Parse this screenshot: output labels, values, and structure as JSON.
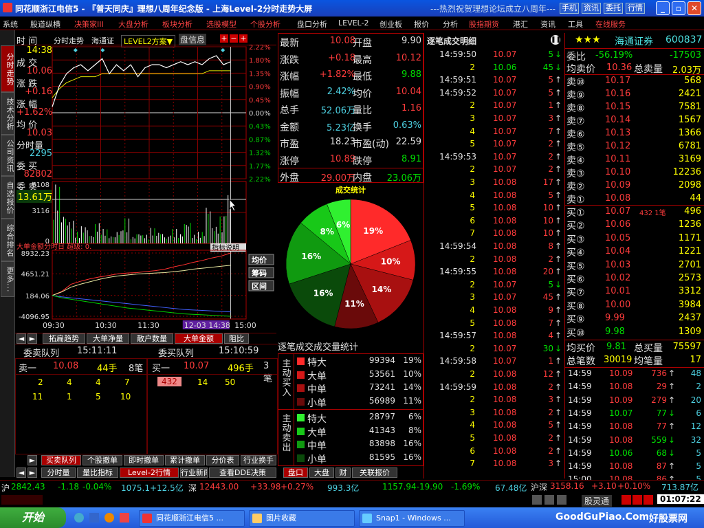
{
  "window": {
    "app_name": "同花顺浙江电信5",
    "title_mid": "『普天同庆』理想八周年纪念版",
    "title_right": "上海Level-2分时走势大屏",
    "marquee": "---热烈祝贺理想论坛成立八周年---",
    "buttons": [
      "手机",
      "资讯",
      "委托",
      "行情"
    ],
    "controls": [
      "_",
      "▫",
      "✕"
    ]
  },
  "menu": [
    "系统",
    "股道纵横",
    "决策家III",
    "大盘分析",
    "板块分析",
    "选股模型",
    "个股分析",
    "盘口分析",
    "LEVEL-2",
    "创业板",
    "报价",
    "分析",
    "股指期货",
    "港汇",
    "资讯",
    "工具",
    "在线服务"
  ],
  "menu_red": [
    "决策家III",
    "大盘分析",
    "板块分析",
    "选股模型",
    "个股分析",
    "股指期货",
    "在线服务"
  ],
  "leftnav": [
    "分时走势",
    "技术分析",
    "公司资讯",
    "自选报价",
    "综合排名",
    "更多..."
  ],
  "chart_header": {
    "tabs": [
      "分时走势",
      "海通证",
      "LEVEL2方案▼"
    ],
    "info_label": "盘信息",
    "plus": "+",
    "minus": "−",
    "plus2": "+"
  },
  "intraday_info": {
    "time_label": "时 间",
    "time": "14:38",
    "deal_label": "成 交",
    "deal": "10.06",
    "chg_label": "涨 跌",
    "chg": "+0.16",
    "pct_label": "涨 幅",
    "pct": "+1.62%",
    "avg_label": "均 价",
    "avg": "10.03",
    "vol_label": "分时量",
    "vol": "2295",
    "buy_label": "委 买",
    "buy": "82802",
    "sell_label": "委 卖",
    "sell": "13.61万"
  },
  "price_axis": [
    "2.22%",
    "1.80%",
    "1.35%",
    "0.90%",
    "0.45%",
    "0.00%",
    "0.43%",
    "0.87%",
    "1.32%",
    "1.77%",
    "2.22%"
  ],
  "vol_axis": [
    "6108",
    "3116",
    "0"
  ],
  "dde": {
    "header": "大单金额分时日 超级: 0.",
    "btn": "指标说明",
    "axis": [
      "8932.23",
      "4651.21",
      "184.06",
      "-4096.95"
    ],
    "side_btns": [
      "均价",
      "筹码",
      "区间"
    ]
  },
  "time_axis": [
    "09:30",
    "10:30",
    "11:30",
    "12-03 14:38",
    "15:00"
  ],
  "chart_tabs": [
    "拓扁趋势",
    "大单净量",
    "散户数量",
    "大单金额",
    "阻比"
  ],
  "chart_data": {
    "type": "line",
    "title": "",
    "x_start": "09:30",
    "x_end": "15:00",
    "price_series": [
      9.92,
      9.99,
      10.03,
      10.05,
      10.06,
      10.04,
      10.06,
      10.08,
      10.03,
      10.06,
      10.04,
      10.06,
      10.02,
      10.05,
      10.06,
      10.06,
      10.05,
      10.06,
      10.07,
      10.06,
      10.07,
      10.06,
      10.08,
      10.09,
      10.06,
      10.07
    ],
    "avg_series": [
      9.95,
      9.98,
      10.0,
      10.01,
      10.02,
      10.02,
      10.02,
      10.03,
      10.03,
      10.03,
      10.03,
      10.03,
      10.03,
      10.03,
      10.03,
      10.03,
      10.03,
      10.03,
      10.03,
      10.03,
      10.03,
      10.03,
      10.04,
      10.04,
      10.04,
      10.04
    ],
    "prev_close": 9.9,
    "ylim_pct": [
      -2.22,
      2.22
    ],
    "vol_series": [
      6108,
      3116,
      2400,
      1200,
      1800,
      900,
      2100,
      1500,
      800,
      1300,
      2600,
      700,
      1100,
      900,
      1600,
      1200,
      700,
      1500,
      1000,
      2295,
      900,
      1200,
      4000,
      1800,
      2800,
      5200
    ],
    "dde_series": {
      "red": [
        184.06,
        1000,
        2500,
        3100,
        3600,
        4000,
        4300,
        4651.21,
        4800,
        4900,
        5100,
        5300,
        5600,
        6100,
        6500,
        7000,
        7400,
        7900,
        8300,
        8932.23
      ],
      "yellow": [
        184.06,
        900,
        1900,
        2500,
        3000,
        3500,
        3900,
        4200,
        4400,
        4600,
        4700,
        4800,
        4900,
        5100,
        5300,
        5600,
        5800,
        6000,
        6200,
        6400
      ],
      "blue": [
        184.06,
        -100,
        -300,
        -500,
        -700,
        -900,
        -1100,
        -1300,
        -1500,
        -1700,
        -1900,
        -2100,
        -2300,
        -2500,
        -2700,
        -2800,
        -2900,
        -3000,
        -3100,
        -3200
      ],
      "green": [
        184.06,
        -300,
        -600,
        -900,
        -1200,
        -1500,
        -1800,
        -2100,
        -2400,
        -2600,
        -2800,
        -3000,
        -3200,
        -3400,
        -3600,
        -3700,
        -3800,
        -3900,
        -4000,
        -4096.95
      ]
    },
    "pie": {
      "title": "成交统计",
      "slices": [
        {
          "pct": 19,
          "label": "19%",
          "color": "#ff2a2a"
        },
        {
          "pct": 10,
          "label": "10%",
          "color": "#d61818"
        },
        {
          "pct": 14,
          "label": "14%",
          "color": "#a81010"
        },
        {
          "pct": 11,
          "label": "11%",
          "color": "#6a0a0a"
        },
        {
          "pct": 16,
          "label": "16%",
          "color": "#0a4a0a"
        },
        {
          "pct": 16,
          "label": "16%",
          "color": "#109a10"
        },
        {
          "pct": 8,
          "label": "8%",
          "color": "#18c818"
        },
        {
          "pct": 6,
          "label": "6%",
          "color": "#30f030"
        }
      ]
    }
  },
  "queues": {
    "sell_title": "委卖队列",
    "sell_time": "15:11:11",
    "buy_title": "委买队列",
    "buy_time": "15:10:59",
    "sell_header": [
      "卖一",
      "10.08",
      "44手",
      "8笔"
    ],
    "sell_rows": [
      [
        "2",
        "4",
        "4",
        "7"
      ],
      [
        "11",
        "1",
        "5",
        "10"
      ]
    ],
    "buy_header": [
      "买一",
      "10.07",
      "496手",
      "3笔"
    ],
    "buy_rows": [
      [
        "432",
        "14",
        "50"
      ]
    ]
  },
  "bottom_tabs1": [
    "买卖队列",
    "个股撤单",
    "即时撤单",
    "累计撤单",
    "分价表",
    "行业换手"
  ],
  "bottom_tabs2": [
    "分时量",
    "量比指标",
    "Level-2行情",
    "行业新闻",
    "查看DDE决策"
  ],
  "quote": {
    "rows": [
      [
        "最新",
        "10.08",
        "开盘",
        "9.90"
      ],
      [
        "涨跌",
        "+0.18",
        "最高",
        "10.12"
      ],
      [
        "涨幅",
        "+1.82%",
        "最低",
        "9.88"
      ],
      [
        "振幅",
        "2.42%",
        "均价",
        "10.04"
      ],
      [
        "总手",
        "52.06万",
        "量比",
        "1.16"
      ],
      [
        "金额",
        "5.23亿",
        "换手",
        "0.63%"
      ],
      [
        "市盈",
        "18.23",
        "市盈(动)",
        "22.59"
      ],
      [
        "涨停",
        "10.89",
        "跌停",
        "8.91"
      ],
      [
        "外盘",
        "29.00万",
        "内盘",
        "23.06万"
      ]
    ]
  },
  "stats": {
    "title": "逐笔成交成交量统计",
    "buy_label": "主动买入",
    "sell_label": "主动卖出",
    "rows": [
      [
        "特大",
        "99394",
        "19%"
      ],
      [
        "大单",
        "53561",
        "10%"
      ],
      [
        "中单",
        "73241",
        "14%"
      ],
      [
        "小单",
        "56989",
        "11%"
      ],
      [
        "特大",
        "28797",
        "6%"
      ],
      [
        "大单",
        "41343",
        "8%"
      ],
      [
        "中单",
        "83898",
        "16%"
      ],
      [
        "小单",
        "81595",
        "16%"
      ]
    ],
    "colors": [
      "#ff2a2a",
      "#d61818",
      "#a81010",
      "#6a0a0a",
      "#30f030",
      "#18c818",
      "#109a10",
      "#0a4a0a"
    ]
  },
  "mid_tabs": [
    "盘口",
    "大盘",
    "财",
    "关联报价"
  ],
  "ticks": {
    "title": "逐笔成交明细",
    "rows": [
      [
        "14:59:50",
        "10.07",
        "5",
        "d"
      ],
      [
        "2",
        "10.06",
        "45",
        "d"
      ],
      [
        "14:59:51",
        "10.07",
        "5",
        "u"
      ],
      [
        "14:59:52",
        "10.07",
        "5",
        "u"
      ],
      [
        "2",
        "10.07",
        "1",
        "u"
      ],
      [
        "3",
        "10.07",
        "3",
        "u"
      ],
      [
        "4",
        "10.07",
        "7",
        "u"
      ],
      [
        "5",
        "10.07",
        "2",
        "u"
      ],
      [
        "14:59:53",
        "10.07",
        "2",
        "u"
      ],
      [
        "2",
        "10.07",
        "2",
        "u"
      ],
      [
        "3",
        "10.08",
        "17",
        "u"
      ],
      [
        "4",
        "10.08",
        "5",
        "u"
      ],
      [
        "5",
        "10.08",
        "10",
        "u"
      ],
      [
        "6",
        "10.08",
        "10",
        "u"
      ],
      [
        "7",
        "10.08",
        "10",
        "u"
      ],
      [
        "14:59:54",
        "10.08",
        "8",
        "u"
      ],
      [
        "2",
        "10.08",
        "2",
        "u"
      ],
      [
        "14:59:55",
        "10.08",
        "20",
        "u"
      ],
      [
        "2",
        "10.07",
        "5",
        "d"
      ],
      [
        "3",
        "10.07",
        "45",
        "u"
      ],
      [
        "4",
        "10.08",
        "9",
        "u"
      ],
      [
        "5",
        "10.08",
        "7",
        "u"
      ],
      [
        "14:59:57",
        "10.08",
        "4",
        "u"
      ],
      [
        "2",
        "10.07",
        "30",
        "d"
      ],
      [
        "14:59:58",
        "10.07",
        "1",
        "u"
      ],
      [
        "2",
        "10.08",
        "12",
        "u"
      ],
      [
        "14:59:59",
        "10.08",
        "2",
        "u"
      ],
      [
        "2",
        "10.08",
        "3",
        "u"
      ],
      [
        "3",
        "10.08",
        "2",
        "u"
      ],
      [
        "4",
        "10.08",
        "5",
        "u"
      ],
      [
        "5",
        "10.08",
        "2",
        "u"
      ],
      [
        "6",
        "10.08",
        "2",
        "u"
      ],
      [
        "7",
        "10.08",
        "3",
        "u"
      ]
    ]
  },
  "stock": {
    "stars": "★★★",
    "name": "海通证券",
    "code": "600837",
    "ratio_label": "委比",
    "ratio": "-56.19%",
    "diff": "-17503",
    "avg_sell_label": "均卖价",
    "avg_sell": "10.36",
    "total_sell_label": "总卖量",
    "total_sell": "2.03万",
    "sells": [
      [
        "卖⑩",
        "10.17",
        "568"
      ],
      [
        "卖⑨",
        "10.16",
        "2421"
      ],
      [
        "卖⑧",
        "10.15",
        "7581"
      ],
      [
        "卖⑦",
        "10.14",
        "1567"
      ],
      [
        "卖⑥",
        "10.13",
        "1366"
      ],
      [
        "卖⑤",
        "10.12",
        "6781"
      ],
      [
        "卖④",
        "10.11",
        "3169"
      ],
      [
        "卖③",
        "10.10",
        "12236"
      ],
      [
        "卖②",
        "10.09",
        "2098"
      ],
      [
        "卖①",
        "10.08",
        "44"
      ]
    ],
    "buys": [
      [
        "买①",
        "10.07",
        "496",
        "432 1笔"
      ],
      [
        "买②",
        "10.06",
        "1236",
        ""
      ],
      [
        "买③",
        "10.05",
        "1171",
        ""
      ],
      [
        "买④",
        "10.04",
        "1221",
        ""
      ],
      [
        "买⑤",
        "10.03",
        "2701",
        ""
      ],
      [
        "买⑥",
        "10.02",
        "2573",
        ""
      ],
      [
        "买⑦",
        "10.01",
        "3312",
        ""
      ],
      [
        "买⑧",
        "10.00",
        "3984",
        ""
      ],
      [
        "买⑨",
        "9.99",
        "2437",
        ""
      ],
      [
        "买⑩",
        "9.98",
        "1309",
        ""
      ]
    ],
    "avg_buy_label": "均买价",
    "avg_buy": "9.81",
    "total_buy_label": "总买量",
    "total_buy": "75597",
    "count_label": "总笔数",
    "count": "30019",
    "avg_qty_label": "均笔量",
    "avg_qty": "17",
    "ticks": [
      [
        "14:59",
        "10.09",
        "736",
        "u",
        "48"
      ],
      [
        "14:59",
        "10.08",
        "29",
        "u",
        "2"
      ],
      [
        "14:59",
        "10.09",
        "279",
        "u",
        "20"
      ],
      [
        "14:59",
        "10.07",
        "77",
        "d",
        "6"
      ],
      [
        "14:59",
        "10.08",
        "77",
        "u",
        "12"
      ],
      [
        "14:59",
        "10.08",
        "559",
        "d",
        "32"
      ],
      [
        "14:59",
        "10.06",
        "68",
        "d",
        "5"
      ],
      [
        "14:59",
        "10.08",
        "87",
        "u",
        "5"
      ],
      [
        "15:00",
        "10.08",
        "86",
        "u",
        "5"
      ],
      [
        "15:00",
        "10.08",
        "68",
        "u",
        "11"
      ]
    ]
  },
  "status": {
    "sh_label": "沪",
    "sh": "2842.43",
    "sh_chg": "-1.18",
    "sh_pct": "-0.04%",
    "sh_amt": "1075.1+12.5亿",
    "sz_label": "深",
    "sz": "12443.00",
    "sz_chg": "+33.98",
    "sz_pct": "+0.27%",
    "sz_amt": "993.3亿",
    "mid": "1157.94-19.90",
    "mid_pct": "-1.69%",
    "mid_amt": "67.48亿",
    "hs_label": "沪深",
    "hs": "3158.16",
    "hs_chg": "+3.10",
    "hs_pct": "+0.10%",
    "hs_amt": "713.87亿",
    "clock": "01:07:22",
    "misc": "股灵通"
  },
  "taskbar": {
    "start": "开始",
    "items": [
      "同花顺浙江电信5 ...",
      "图片收藏",
      "Snap1 - Windows ..."
    ],
    "watermark": "GoodGuPiao.Com",
    "watermark2": "好股票网"
  }
}
